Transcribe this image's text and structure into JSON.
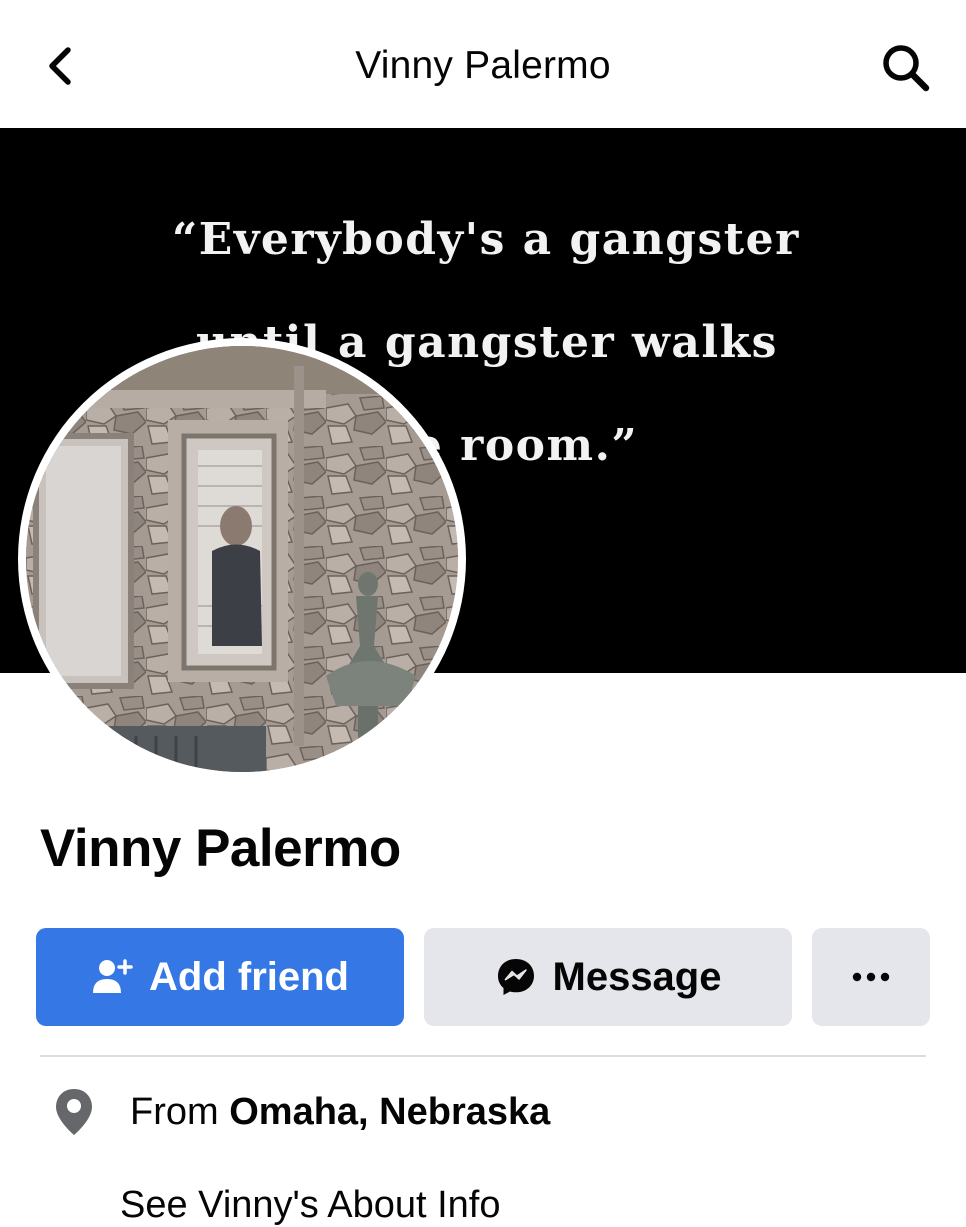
{
  "header": {
    "title": "Vinny Palermo",
    "back_icon": "chevron-left-icon",
    "search_icon": "search-icon"
  },
  "cover": {
    "quote_lines": [
      "“Everybody's a gangster",
      "until a gangster walks",
      "in the room.”"
    ],
    "background": "#000000"
  },
  "profile": {
    "name": "Vinny Palermo"
  },
  "actions": {
    "add_friend_label": "Add friend",
    "message_label": "Message",
    "more_label": "•••",
    "add_friend_color": "#3578e5",
    "secondary_color": "#e4e6eb"
  },
  "intro": {
    "from_prefix": "From",
    "from_location": "Omaha, Nebraska",
    "about_label": "See Vinny's About Info"
  }
}
